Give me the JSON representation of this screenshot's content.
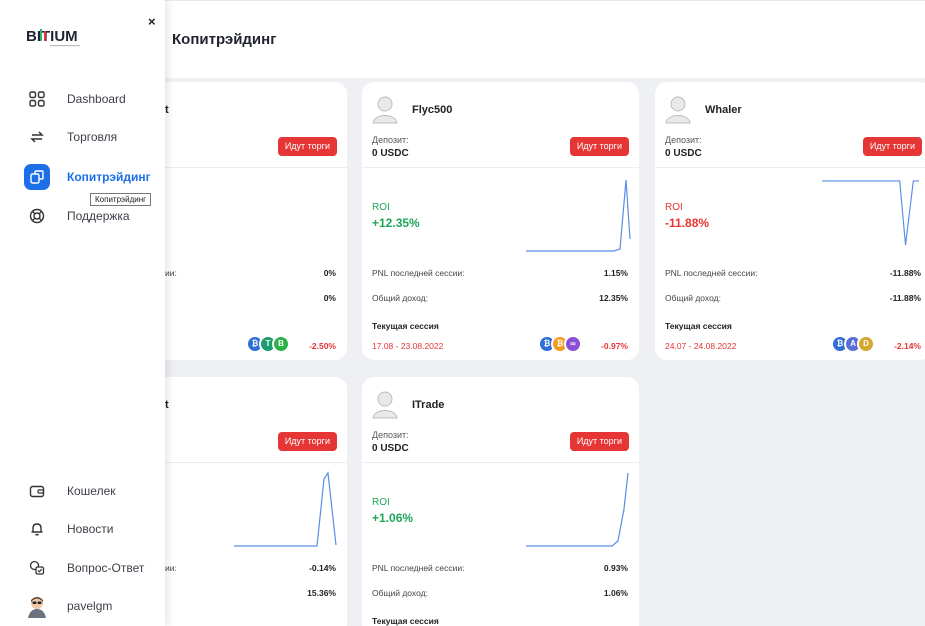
{
  "page": {
    "title": "Копитрэйдинг"
  },
  "sidebar": {
    "logo": "BITIUM",
    "close_label": "×",
    "tooltip": "Копитрэйдинг",
    "items": [
      {
        "label": "Dashboard",
        "icon": "dashboard-grid-icon"
      },
      {
        "label": "Торговля",
        "icon": "exchange-arrows-icon"
      },
      {
        "label": "Копитрэйдинг",
        "icon": "copy-icon",
        "active": true
      },
      {
        "label": "Поддержка",
        "icon": "lifebuoy-icon"
      }
    ],
    "bottom_items": [
      {
        "label": "Кошелек",
        "icon": "wallet-icon"
      },
      {
        "label": "Новости",
        "icon": "bell-icon"
      },
      {
        "label": "Вопрос-Ответ",
        "icon": "faq-icon"
      },
      {
        "label": "pavelgm",
        "icon": "user-avatar-icon"
      }
    ]
  },
  "labels": {
    "deposit": "Депозит:",
    "status": "Идут торги",
    "roi": "ROI",
    "pnl_last": "PNL последней сессии:",
    "pnl_last_partial": "ии:",
    "total_income": "Общий доход:",
    "current_session": "Текущая сессия"
  },
  "colors": {
    "accent": "#1d6fe8",
    "positive": "#1fa65a",
    "negative": "#e63535",
    "spark": "#5a8ee6"
  },
  "cards": [
    {
      "name_partial": "t",
      "status": "Идут торги",
      "pnl_last": "0%",
      "total_income": "0%",
      "session_pnl": "-2.50%",
      "coins": [
        {
          "letter": "₿",
          "color": "#2f6fd6"
        },
        {
          "letter": "T",
          "color": "#1e9c6e"
        },
        {
          "letter": "B",
          "color": "#2db24a"
        }
      ]
    },
    {
      "name": "Flyc500",
      "deposit": "0 USDC",
      "status": "Идут торги",
      "roi": "+12.35%",
      "pnl_last": "1.15%",
      "total_income": "12.35%",
      "session_dates": "17.08 - 23.08.2022",
      "session_pnl": "-0.97%",
      "coins": [
        {
          "letter": "₿",
          "color": "#2f6fd6"
        },
        {
          "letter": "₿",
          "color": "#f39c1f"
        },
        {
          "letter": "∞",
          "color": "#8a4fd8"
        }
      ]
    },
    {
      "name": "Whaler",
      "deposit": "0 USDC",
      "status": "Идут торги",
      "roi": "-11.88%",
      "pnl_last": "-11.88%",
      "total_income": "-11.88%",
      "session_dates": "24.07 - 24.08.2022",
      "session_pnl": "-2.14%",
      "coins": [
        {
          "letter": "₿",
          "color": "#2f6fd6"
        },
        {
          "letter": "A",
          "color": "#5a6fd6"
        },
        {
          "letter": "D",
          "color": "#d6a72f"
        }
      ]
    },
    {
      "name_partial": "t",
      "status": "Идут торги",
      "pnl_last": "-0.14%",
      "total_income": "15.36%"
    },
    {
      "name": "ITrade",
      "deposit": "0 USDC",
      "status": "Идут торги",
      "roi": "+1.06%",
      "pnl_last": "0.93%",
      "total_income": "1.06%"
    }
  ]
}
